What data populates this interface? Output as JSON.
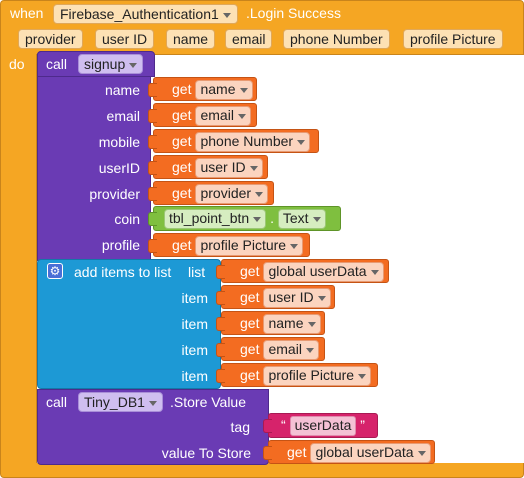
{
  "event": {
    "when_label": "when",
    "component": "Firebase_Authentication1",
    "event_name": ".Login Success",
    "params": [
      "provider",
      "user ID",
      "name",
      "email",
      "phone Number",
      "profile Picture"
    ],
    "do_label": "do"
  },
  "signup_call": {
    "call_label": "call",
    "procedure": "signup",
    "args": [
      {
        "name": "name",
        "get": "name"
      },
      {
        "name": "email",
        "get": "email"
      },
      {
        "name": "mobile",
        "get": "phone Number"
      },
      {
        "name": "userID",
        "get": "user ID"
      },
      {
        "name": "provider",
        "get": "provider"
      },
      {
        "name": "coin",
        "component": "tbl_point_btn",
        "property": "Text"
      },
      {
        "name": "profile",
        "get": "profile Picture"
      }
    ],
    "get_label": "get"
  },
  "add_items": {
    "label": "add items to list",
    "list_label": "list",
    "list_var": "global userData",
    "item_label": "item",
    "items": [
      "user ID",
      "name",
      "email",
      "profile Picture"
    ]
  },
  "store_call": {
    "call_label": "call",
    "component": "Tiny_DB1",
    "method": ".Store Value",
    "tag_label": "tag",
    "tag_open_quote": "“",
    "tag_value": "userData",
    "tag_close_quote": "”",
    "value_label": "value To Store",
    "value_var": "global userData"
  },
  "colors": {
    "event": "#f5a623",
    "procedure": "#6a3bb4",
    "variable_get": "#f36c21",
    "list": "#1d99d5",
    "component_property": "#7fbf3f",
    "text": "#d6236b"
  }
}
